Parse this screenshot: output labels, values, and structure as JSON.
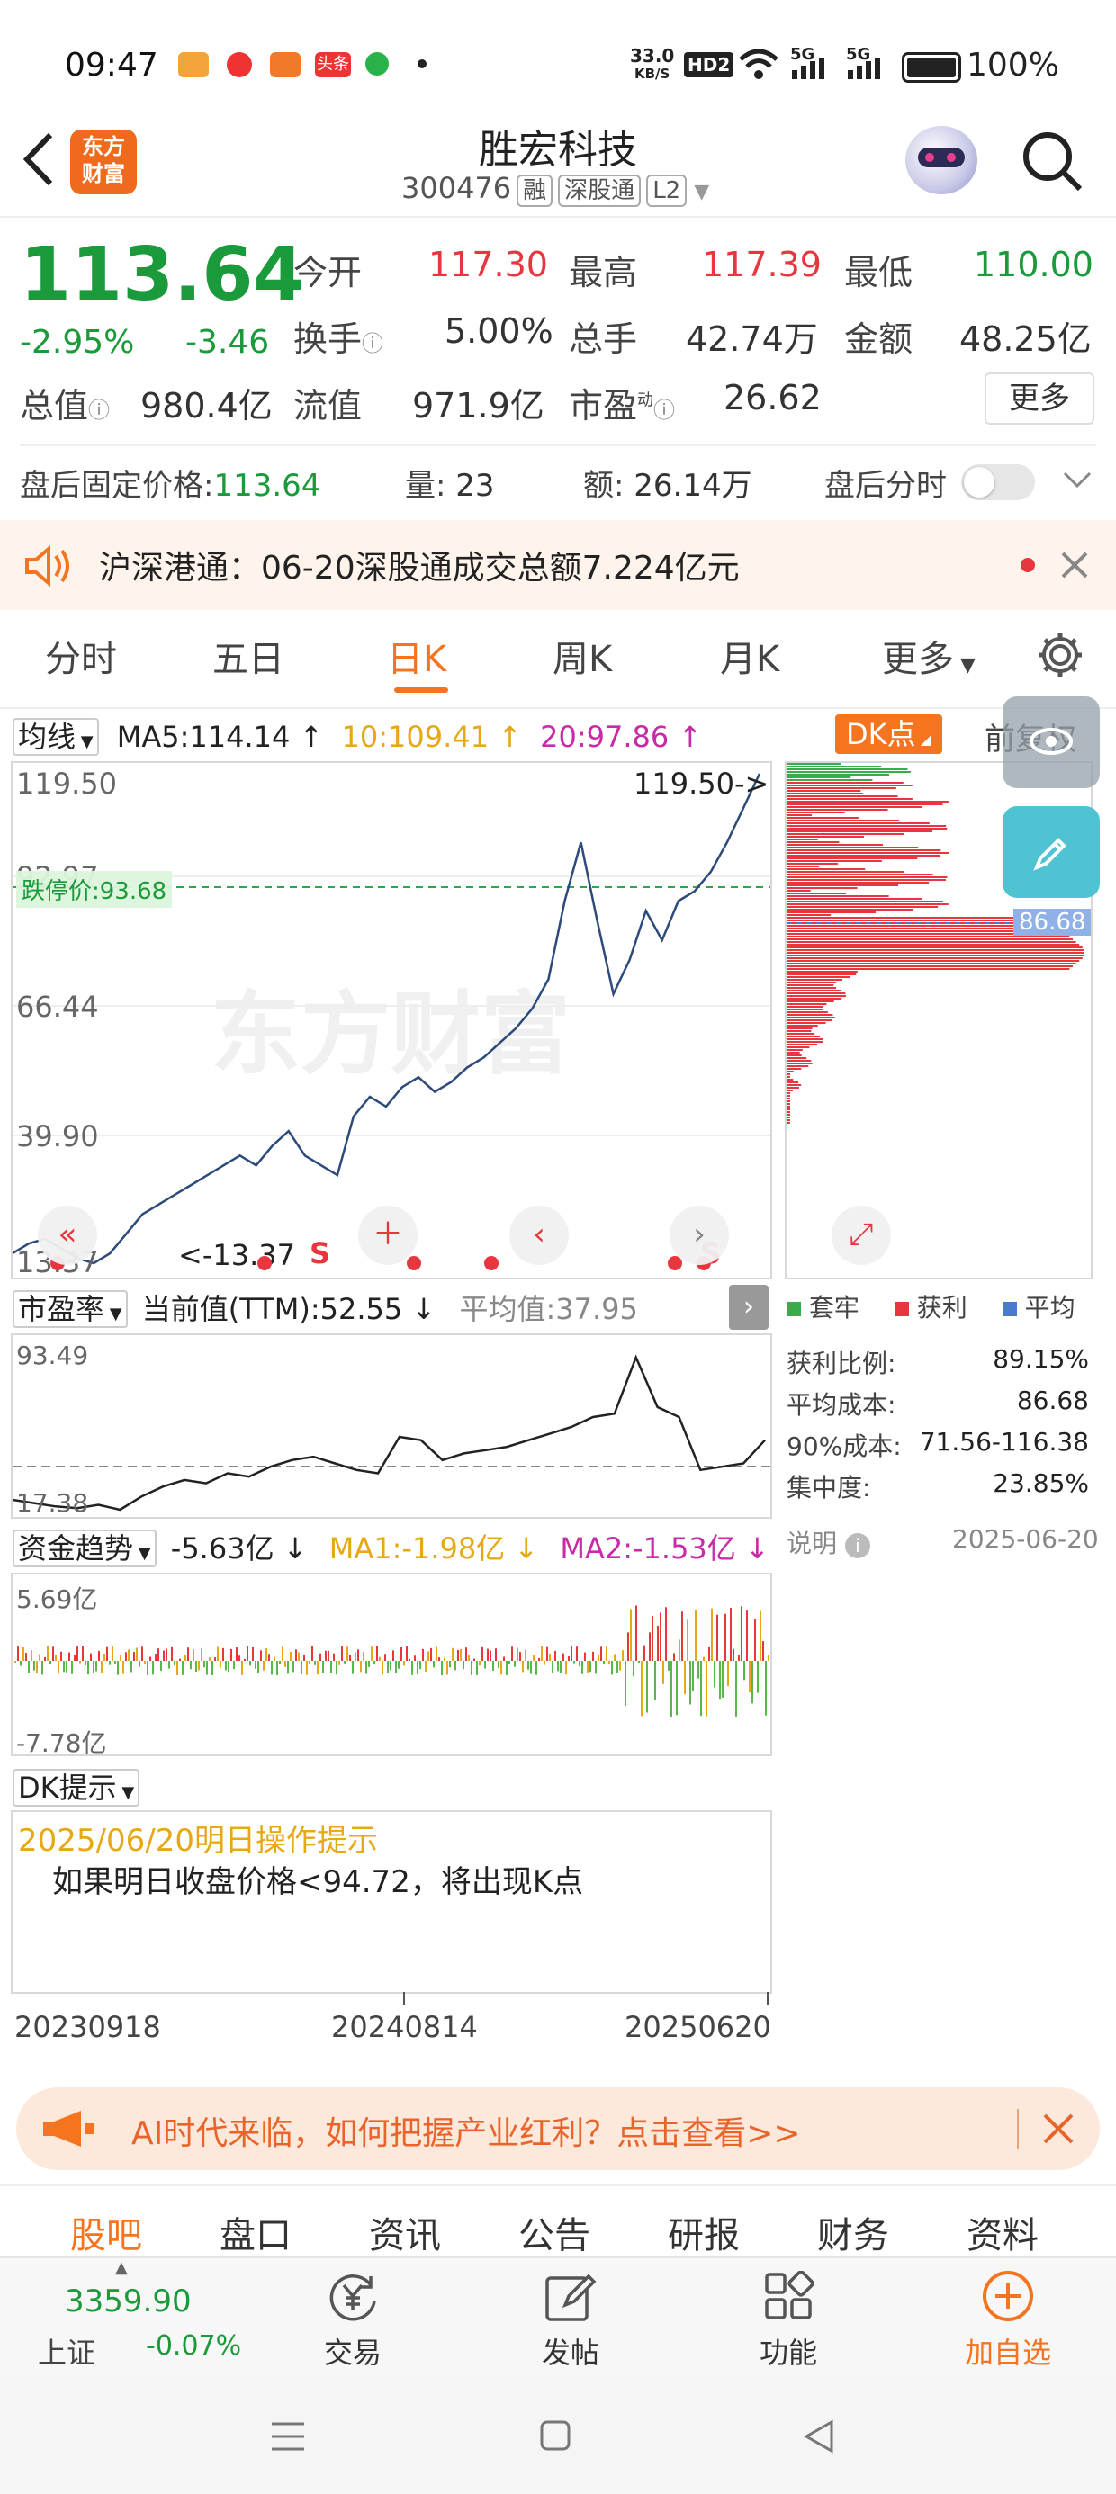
{
  "status": {
    "time": "09:47",
    "net_speed": "33.0",
    "net_unit": "KB/S",
    "hd": "HD2",
    "sig1": "5G",
    "sig2": "5G",
    "battery": "100%"
  },
  "header": {
    "logo_line1": "东方",
    "logo_line2": "财富",
    "title": "胜宏科技",
    "code": "300476",
    "tags": [
      "融",
      "深股通",
      "L2"
    ]
  },
  "quote": {
    "price": "113.64",
    "change_pct": "-2.95%",
    "change": "-3.46",
    "open_label": "今开",
    "open": "117.30",
    "high_label": "最高",
    "high": "117.39",
    "low_label": "最低",
    "low": "110.00",
    "turnover_label": "换手",
    "turnover": "5.00%",
    "volume_label": "总手",
    "volume": "42.74万",
    "amount_label": "金额",
    "amount": "48.25亿",
    "mktcap_label": "总值",
    "mktcap": "980.4亿",
    "float_label": "流值",
    "float": "971.9亿",
    "pe_label": "市盈",
    "pe_sup": "动",
    "pe": "26.62",
    "more": "更多"
  },
  "afterhours": {
    "label": "盘后固定价格:",
    "price": "113.64",
    "qty_label": "量:",
    "qty": "23",
    "amt_label": "额:",
    "amt": "26.14万",
    "toggle_label": "盘后分时"
  },
  "notice": {
    "text": "沪深港通：06-20深股通成交总额7.224亿元"
  },
  "tabs": [
    "分时",
    "五日",
    "日K",
    "周K",
    "月K",
    "更多"
  ],
  "active_tab": "日K",
  "ma": {
    "selector": "均线",
    "ma5": "MA5:114.14",
    "ma10": "10:109.41",
    "ma20": "20:97.86",
    "dk": "DK点",
    "fq": "前复权"
  },
  "kchart": {
    "y_top": "119.50",
    "y_2": "92.97",
    "y_3": "66.44",
    "y_4": "39.90",
    "y_5": "13.37",
    "max_label": "119.50->",
    "min_label": "<-13.37",
    "limit_down": "跌停价:93.68",
    "chip_avg": "86.68",
    "s_marker": "S"
  },
  "chip_legend": {
    "trap": "套牢",
    "profit": "获利",
    "avg": "平均"
  },
  "chip_stats": {
    "profit_ratio_label": "获利比例:",
    "profit_ratio": "89.15%",
    "avg_cost_label": "平均成本:",
    "avg_cost": "86.68",
    "cost90_label": "90%成本:",
    "cost90": "71.56-116.38",
    "concentration_label": "集中度:",
    "concentration": "23.85%",
    "note": "说明",
    "date": "2025-06-20"
  },
  "pe_panel": {
    "selector": "市盈率",
    "current": "当前值(TTM):52.55",
    "avg": "平均值:37.95",
    "y_top": "93.49",
    "y_bottom": "17.38"
  },
  "fund_panel": {
    "selector": "资金趋势",
    "value": "-5.63亿",
    "ma1": "MA1:-1.98亿",
    "ma2": "MA2:-1.53亿",
    "y_top": "5.69亿",
    "y_bottom": "-7.78亿"
  },
  "dk_panel": {
    "selector": "DK提示",
    "date_line": "2025/06/20明日操作提示",
    "text": "如果明日收盘价格<94.72，将出现K点"
  },
  "x_axis": {
    "start": "20230918",
    "mid": "20240814",
    "end": "20250620"
  },
  "ad": {
    "text": "AI时代来临，如何把握产业红利？点击查看>>"
  },
  "subtabs": [
    "股吧",
    "盘口",
    "资讯",
    "公告",
    "研报",
    "财务",
    "资料"
  ],
  "bottom": {
    "index_value": "3359.90",
    "index_name": "上证",
    "index_change": "-0.07%",
    "trade": "交易",
    "post": "发帖",
    "func": "功能",
    "add": "加自选"
  },
  "colors": {
    "red": "#e8363e",
    "green": "#1a9a3a",
    "orange": "#f4741f",
    "line": "#2c4a7a"
  }
}
